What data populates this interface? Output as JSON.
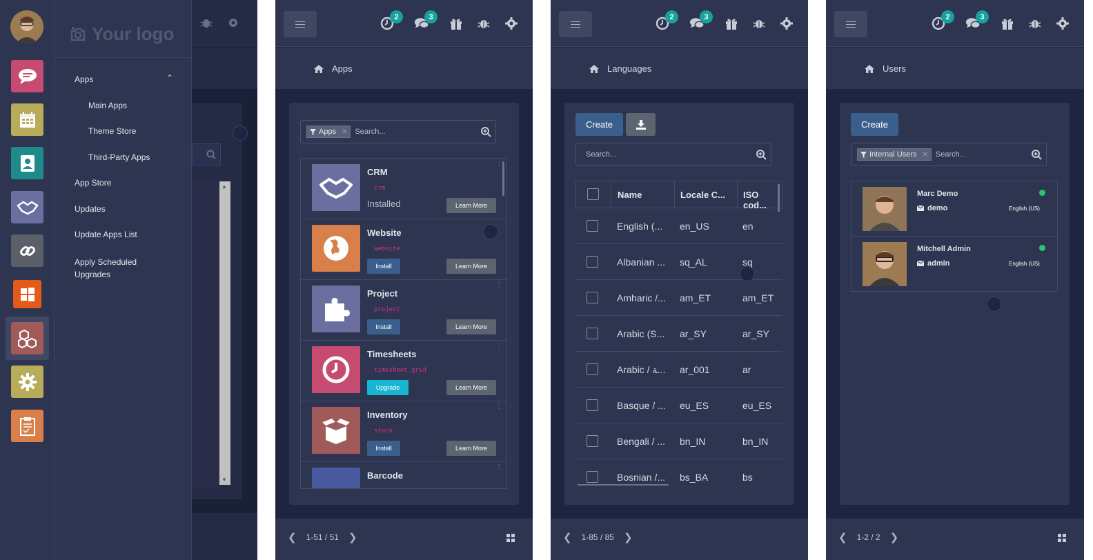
{
  "topbar": {
    "badge_activities": "2",
    "badge_messages": "3"
  },
  "panel1": {
    "logo_text": "Your logo",
    "menu": {
      "apps": "Apps",
      "main_apps": "Main Apps",
      "theme_store": "Theme Store",
      "third_party_apps": "Third-Party Apps",
      "app_store": "App Store",
      "updates": "Updates",
      "update_apps_list": "Update Apps List",
      "apply_scheduled_upgrades": "Apply Scheduled Upgrades"
    },
    "rail_apps": [
      "discuss-icon",
      "calendar-icon",
      "contacts-icon",
      "crm-handshake-icon",
      "link-icon",
      "windows-icon",
      "apps-cubes-icon",
      "settings-gear-icon",
      "timesheet-clipboard-icon"
    ],
    "colors": {
      "discuss": "#c64b70",
      "calendar": "#b8ac5b",
      "contacts": "#1f8a8a",
      "crm": "#6b6fa0",
      "link": "#5a5f6a",
      "windows": "#e45a17",
      "apps": "#a05a5a",
      "settings": "#b8ac5b",
      "timesheet": "#d9804a"
    }
  },
  "panel2": {
    "breadcrumb": "Apps",
    "facet": "Apps",
    "search_placeholder": "Search...",
    "apps": [
      {
        "name": "CRM",
        "technical": "crm",
        "status": "Installed",
        "action": "",
        "learn": "Learn More",
        "color": "#6b6fa0",
        "icon": "handshake-icon"
      },
      {
        "name": "Website",
        "technical": "website",
        "status": "",
        "action": "Install",
        "learn": "Learn More",
        "color": "#d9804a",
        "icon": "globe-icon"
      },
      {
        "name": "Project",
        "technical": "project",
        "status": "",
        "action": "Install",
        "learn": "Learn More",
        "color": "#6b6fa0",
        "icon": "puzzle-icon"
      },
      {
        "name": "Timesheets",
        "technical": "timesheet_grid",
        "status": "",
        "action": "Upgrade",
        "learn": "Learn More",
        "color": "#c64b70",
        "icon": "clock-icon"
      },
      {
        "name": "Inventory",
        "technical": "stock",
        "status": "",
        "action": "Install",
        "learn": "Learn More",
        "color": "#a05a5a",
        "icon": "box-icon"
      },
      {
        "name": "Barcode",
        "technical": "",
        "status": "",
        "action": "",
        "learn": "",
        "color": "#4a5aa0",
        "icon": "barcode-icon"
      }
    ],
    "pager": "1-51 / 51"
  },
  "panel3": {
    "breadcrumb": "Languages",
    "create": "Create",
    "search_placeholder": "Search...",
    "columns": [
      "Name",
      "Locale C...",
      "ISO cod..."
    ],
    "rows": [
      [
        "English (...",
        "en_US",
        "en"
      ],
      [
        "Albanian ...",
        "sq_AL",
        "sq"
      ],
      [
        "Amharic /...",
        "am_ET",
        "am_ET"
      ],
      [
        "Arabic (S...",
        "ar_SY",
        "ar_SY"
      ],
      [
        "Arabic / ﺔ...",
        "ar_001",
        "ar"
      ],
      [
        "Basque / ...",
        "eu_ES",
        "eu_ES"
      ],
      [
        "Bengali / ...",
        "bn_IN",
        "bn_IN"
      ],
      [
        "Bosnian /...",
        "bs_BA",
        "bs"
      ]
    ],
    "pager": "1-85 / 85"
  },
  "panel4": {
    "breadcrumb": "Users",
    "create": "Create",
    "facet": "Internal Users",
    "search_placeholder": "Search...",
    "users": [
      {
        "name": "Marc Demo",
        "login": "demo",
        "lang": "English (US)"
      },
      {
        "name": "Mitchell Admin",
        "login": "admin",
        "lang": "English (US)"
      }
    ],
    "pager": "1-2 / 2"
  }
}
